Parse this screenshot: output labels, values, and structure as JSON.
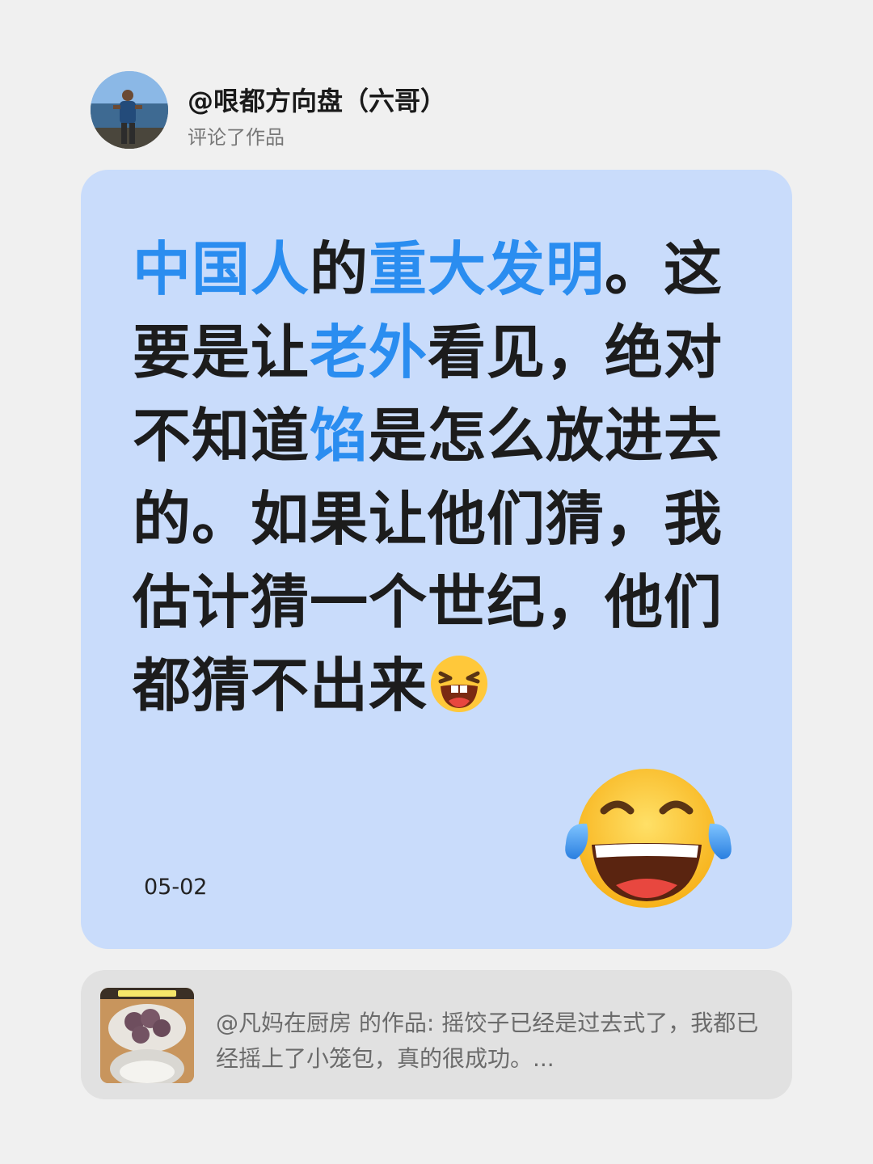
{
  "header": {
    "username": "@哏都方向盘（六哥）",
    "action": "评论了作品",
    "avatar_icon": "user-avatar-photo"
  },
  "comment": {
    "segments": [
      {
        "text": "中国人",
        "highlight": true
      },
      {
        "text": "的",
        "highlight": false
      },
      {
        "text": "重大发明",
        "highlight": true
      },
      {
        "text": "。这要是让",
        "highlight": false
      },
      {
        "text": "老外",
        "highlight": true
      },
      {
        "text": "看见，绝对不知道",
        "highlight": false
      },
      {
        "text": "馅",
        "highlight": true
      },
      {
        "text": "是怎么放进去的。如果让他们猜，我估计猜一个世纪，他们都猜不出来",
        "highlight": false
      }
    ],
    "inline_emoji": "laughing-grin-emoji",
    "large_emoji": "tears-of-joy-emoji",
    "date": "05-02",
    "highlight_color": "#2a8df0",
    "card_color": "#c9dcfb"
  },
  "video": {
    "description": "@凡妈在厨房 的作品: 摇饺子已经是过去式了，我都已经摇上了小笼包，真的很成功。...",
    "thumb_icon": "dumplings-thumbnail"
  }
}
